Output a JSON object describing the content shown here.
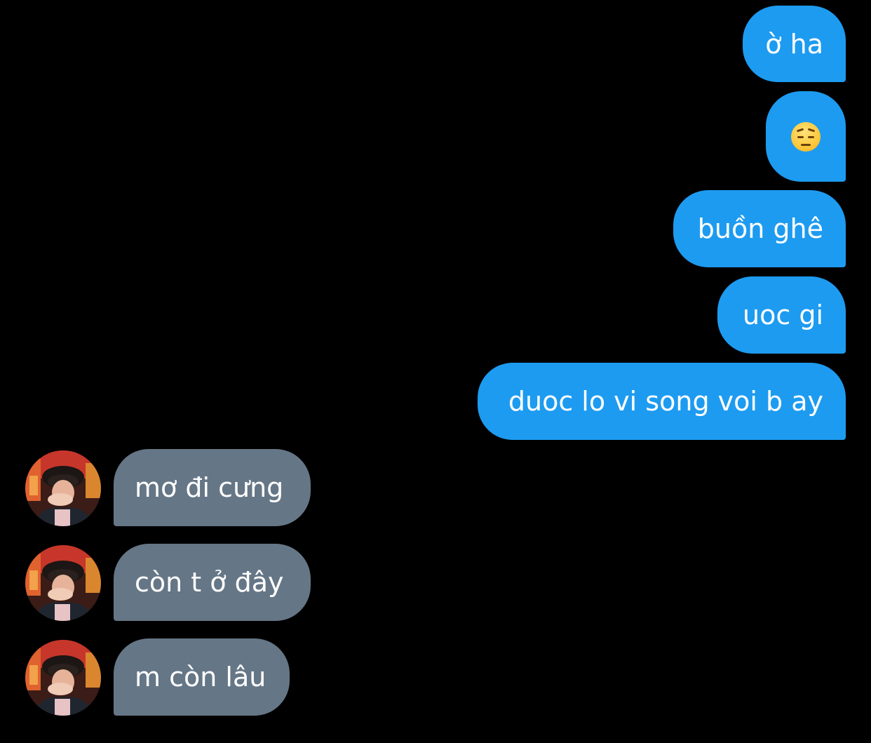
{
  "conversation": {
    "outgoing": [
      {
        "text": "ờ ha"
      },
      {
        "emoji": "pensive-face-emoji"
      },
      {
        "text": "buồn ghê"
      },
      {
        "text": "uoc gi"
      },
      {
        "text": "duoc lo vi song voi b ay"
      }
    ],
    "incoming": [
      {
        "text": "mơ đi cưng"
      },
      {
        "text": "còn t ở đây"
      },
      {
        "text": "m còn lâu"
      }
    ]
  },
  "colors": {
    "background": "#000000",
    "outgoing_bubble": "#1d9bf0",
    "incoming_bubble": "#657686",
    "text": "#ffffff"
  },
  "icons": {
    "avatar": "user-avatar-photo"
  }
}
